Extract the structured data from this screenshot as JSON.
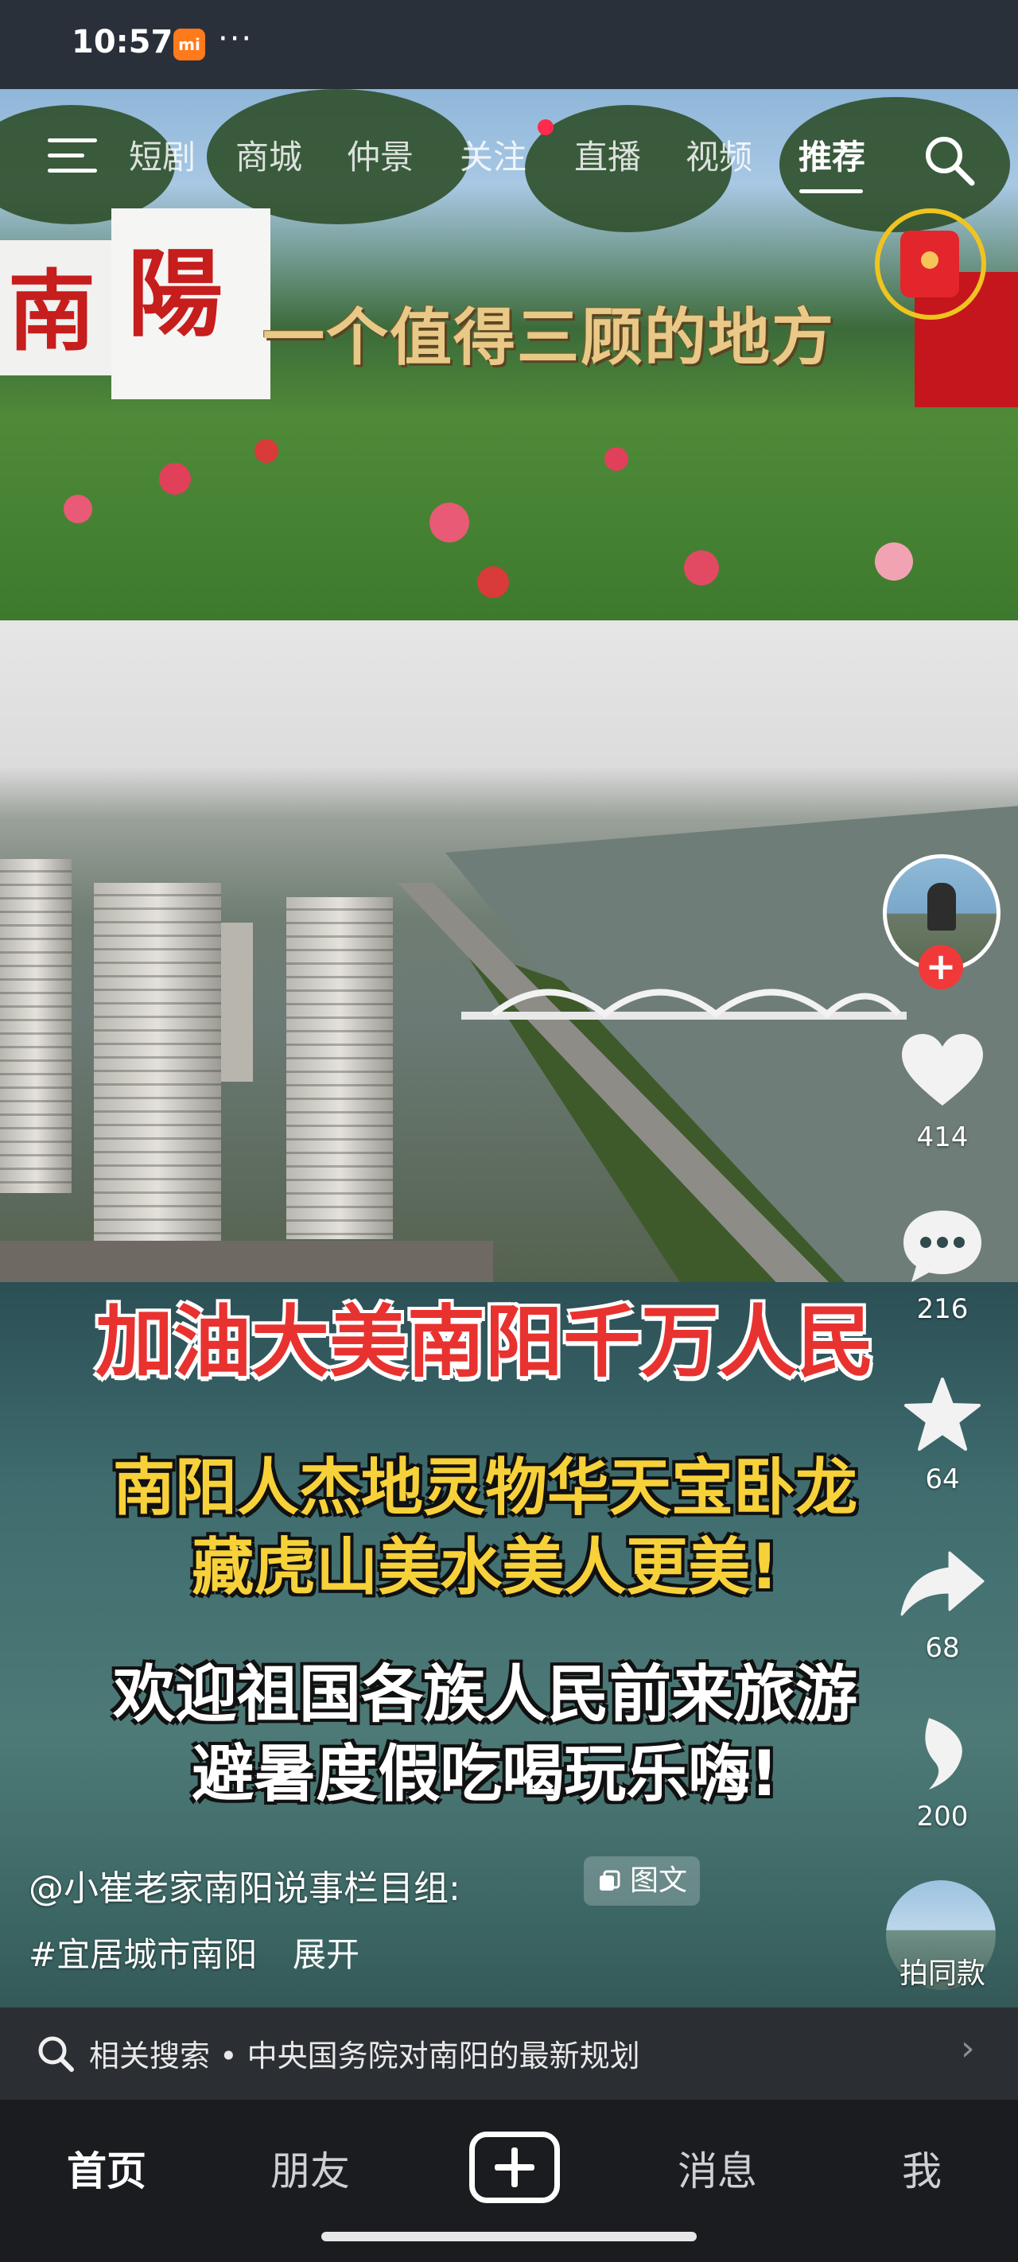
{
  "status_bar": {
    "time": "10:57",
    "mi_badge": "mi",
    "more_dots": "···"
  },
  "top_tabs": {
    "items": [
      "短剧",
      "商城",
      "仲景",
      "关注",
      "直播",
      "视频",
      "推荐"
    ],
    "active": "推荐"
  },
  "video": {
    "sign_char_1": "南",
    "sign_char_2": "陽",
    "slogan": "一个值得三顾的地方",
    "title_red": "加油大美南阳千万人民",
    "yellow_line_1": "南阳人杰地灵物华天宝卧龙",
    "yellow_line_2": "藏虎山美水美人更美!",
    "white_line_1": "欢迎祖国各族人民前来旅游",
    "white_line_2": "避暑度假吃喝玩乐嗨!"
  },
  "right_rail": {
    "likes": "414",
    "comments": "216",
    "favorites": "64",
    "shares": "68",
    "recommend": "200",
    "remix_label": "拍同款",
    "follow_symbol": "+"
  },
  "caption": {
    "author": "@小崔老家南阳说事栏目组:",
    "badge": "图文",
    "hashtag": "#宜居城市南阳",
    "expand": "展开"
  },
  "related_search": {
    "text": "相关搜索 • 中央国务院对南阳的最新规划",
    "chevron": "›"
  },
  "bottom_nav": {
    "home": "首页",
    "friends": "朋友",
    "messages": "消息",
    "me": "我"
  },
  "colors": {
    "accent_red": "#f03a3a",
    "title_red": "#e8322f",
    "caption_yellow": "#f7d13a",
    "nav_bg": "#1b1c20"
  },
  "icons": [
    "menu-icon",
    "search-icon",
    "red-packet-icon",
    "heart-icon",
    "comment-icon",
    "star-icon",
    "share-icon",
    "recommend-icon",
    "image-text-icon",
    "create-icon"
  ]
}
